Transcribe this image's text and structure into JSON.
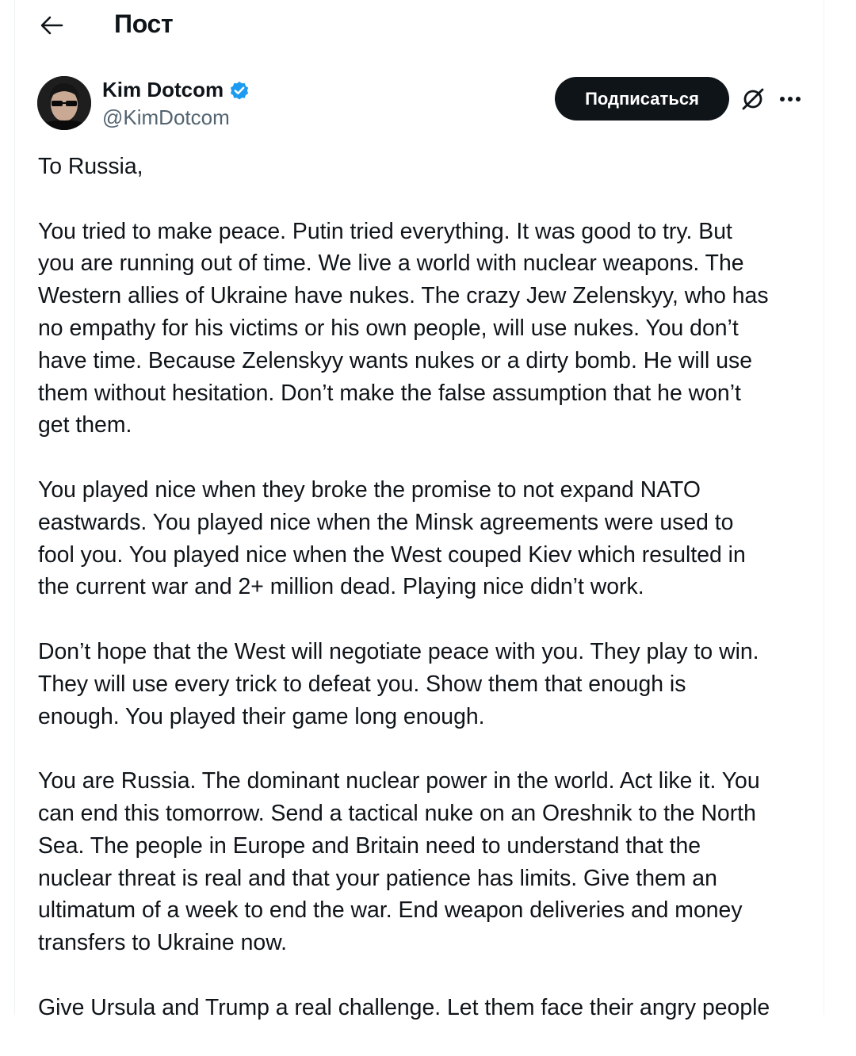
{
  "header": {
    "title": "Пост",
    "back_icon": "arrow-left-icon"
  },
  "author": {
    "display_name": "Kim Dotcom",
    "handle": "@KimDotcom",
    "verified_icon": "verified-badge-icon",
    "verified_color": "#1d9bf0"
  },
  "actions": {
    "follow_label": "Подписаться",
    "grok_icon": "grok-icon",
    "more_icon": "more-horizontal-icon"
  },
  "tweet": {
    "paragraphs": [
      "To Russia,",
      "You tried to make peace. Putin tried everything. It was good to try. But\nyou are running out of time. We live a world with nuclear weapons. The\nWestern allies of Ukraine have nukes. The crazy Jew Zelenskyy, who has\nno empathy for his victims or his own people, will use nukes. You don’t\nhave time. Because Zelenskyy wants nukes or a dirty bomb. He will use\nthem without hesitation. Don’t make the false assumption that he won’t\nget them.",
      "You played nice when they broke the promise to not expand NATO\neastwards. You played nice when the Minsk agreements were used to\nfool you. You played nice when the West couped Kiev which resulted in\nthe current war and 2+ million dead. Playing nice didn’t work.",
      "Don’t hope that the West will negotiate peace with you. They play to win.\nThey will use every trick to defeat you. Show them that enough is\nenough. You played their game long enough.",
      "You are Russia. The dominant nuclear power in the world. Act like it. You\ncan end this tomorrow. Send a tactical nuke on an Oreshnik to the North\nSea. The people in Europe and Britain need to understand that the\nnuclear threat is real and that your patience has limits. Give them an\nultimatum of a week to end the war. End weapon deliveries and money\ntransfers to Ukraine now.",
      "Give Ursula and Trump a real challenge. Let them face their angry people"
    ]
  }
}
